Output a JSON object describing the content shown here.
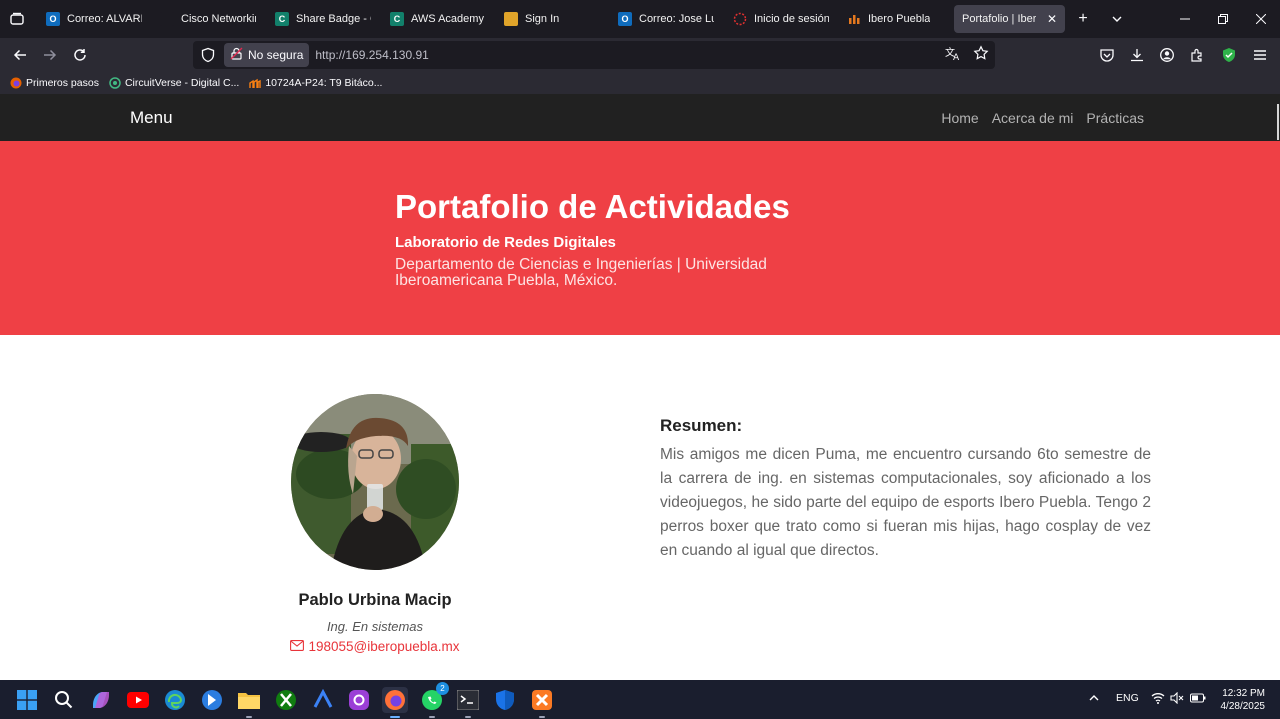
{
  "browser": {
    "tabs": [
      {
        "title": "Correo: ALVAREZ",
        "favicon": "outlook-icon",
        "color": "#0f6cbd"
      },
      {
        "title": "Cisco Networking",
        "favicon": "cisco-icon",
        "color": "#1c1b22"
      },
      {
        "title": "Share Badge - Cre",
        "favicon": "credly-icon",
        "color": "#12806b"
      },
      {
        "title": "AWS Academy Gr",
        "favicon": "credly-icon",
        "color": "#12806b"
      },
      {
        "title": "Sign In",
        "favicon": "box-icon",
        "color": "#e0a42a"
      },
      {
        "title": "Correo: Jose Luis",
        "favicon": "outlook-icon",
        "color": "#0f6cbd"
      },
      {
        "title": "Inicio de sesión e",
        "favicon": "loading-icon",
        "color": "#e0302f"
      },
      {
        "title": "Ibero Puebla",
        "favicon": "ibero-icon",
        "color": "#e5781f"
      },
      {
        "title": "Portafolio | Ibero Pu",
        "favicon": "none",
        "color": ""
      }
    ],
    "security_label": "No segura",
    "url": "http://169.254.130.91",
    "bookmarks": [
      {
        "label": "Primeros pasos",
        "icon": "firefox-icon"
      },
      {
        "label": "CircuitVerse - Digital C...",
        "icon": "circuitverse-icon"
      },
      {
        "label": "10724A-P24: T9 Bitáco...",
        "icon": "moodle-icon"
      }
    ]
  },
  "site": {
    "brand": "Menu",
    "nav_links": [
      "Home",
      "Acerca de mi",
      "Prácticas"
    ],
    "hero": {
      "title": "Portafolio de Actividades",
      "subtitle": "Laboratorio de Redes Digitales",
      "department": "Departamento de Ciencias e Ingenierías | Universidad Iberoamericana Puebla, México."
    },
    "profile": {
      "name": "Pablo Urbina Macip",
      "role": "Ing. En sistemas",
      "email": "198055@iberopuebla.mx"
    },
    "summary": {
      "title": "Resumen:",
      "text": "Mis amigos me dicen Puma, me encuentro cursando 6to semestre de la carrera de ing. en sistemas computacionales, soy aficionado a los videojuegos, he sido parte del equipo de esports Ibero Puebla. Tengo 2 perros boxer que trato como si fueran mis hijas, hago cosplay de vez en cuando al igual que directos."
    },
    "accent_color": "#ef4045"
  },
  "taskbar": {
    "apps": [
      "start-icon",
      "search-icon",
      "copilot-icon",
      "youtube-icon",
      "edge-icon",
      "bing-icon",
      "file-explorer-icon",
      "xbox-icon",
      "arc-icon",
      "instagram-icon",
      "firefox-icon",
      "whatsapp-icon",
      "terminal-icon",
      "defender-icon",
      "xampp-icon"
    ],
    "whatsapp_badge": "2",
    "language": "ENG",
    "time": "12:32 PM",
    "date": "4/28/2025"
  }
}
